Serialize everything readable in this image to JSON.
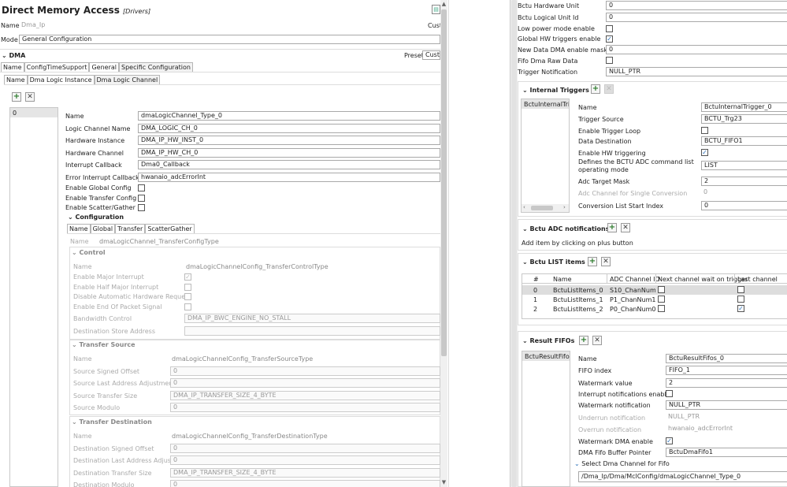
{
  "left": {
    "title": "Direct Memory Access",
    "title_suffix": "[Drivers]",
    "name_label": "Name",
    "name_value": "Dma_Ip",
    "custom_label": "Cust",
    "mode_label": "Mode",
    "mode_value": "General Configuration",
    "dma_section": "DMA",
    "preset_label": "Preset",
    "preset_value": "Custo",
    "top_tabs": [
      "Name",
      "ConfigTimeSupport",
      "General",
      "Specific Configuration"
    ],
    "sub_tabs": [
      "Name",
      "Dma Logic Instance",
      "Dma Logic Channel"
    ],
    "list_items": [
      "0"
    ],
    "fields": [
      {
        "label": "Name",
        "value": "dmaLogicChannel_Type_0"
      },
      {
        "label": "Logic Channel Name",
        "value": "DMA_LOGIC_CH_0"
      },
      {
        "label": "Hardware Instance",
        "value": "DMA_IP_HW_INST_0"
      },
      {
        "label": "Hardware Channel",
        "value": "DMA_IP_HW_CH_0"
      },
      {
        "label": "Interrupt Callback",
        "value": "Dma0_Callback"
      },
      {
        "label": "Error Interrupt Callback",
        "value": "hwanaio_adcErrorInt"
      }
    ],
    "checks": [
      {
        "label": "Enable Global Config",
        "checked": false
      },
      {
        "label": "Enable Transfer Config",
        "checked": false
      },
      {
        "label": "Enable Scatter/Gather",
        "checked": false
      }
    ],
    "configuration_section": "Configuration",
    "config_tabs": [
      "Name",
      "Global",
      "Transfer",
      "ScatterGather"
    ],
    "config_name_label": "Name",
    "config_name_value": "dmaLogicChannel_TransferConfigType",
    "control": {
      "title": "Control",
      "name_label": "Name",
      "name_value": "dmaLogicChannelConfig_TransferControlType",
      "checks": [
        {
          "label": "Enable Major Interrupt",
          "checked": true
        },
        {
          "label": "Enable Half Major Interrupt",
          "checked": false
        },
        {
          "label": "Disable Automatic Hardware Request",
          "checked": false
        },
        {
          "label": "Enable End Of Packet Signal",
          "checked": false
        }
      ],
      "bw_label": "Bandwidth Control",
      "bw_value": "DMA_IP_BWC_ENGINE_NO_STALL",
      "dest_store_label": "Destination Store Address",
      "dest_store_value": ""
    },
    "source": {
      "title": "Transfer Source",
      "rows": [
        {
          "label": "Name",
          "value": "dmaLogicChannelConfig_TransferSourceType"
        },
        {
          "label": "Source Signed Offset",
          "value": "0"
        },
        {
          "label": "Source Last Address Adjustment",
          "value": "0"
        },
        {
          "label": "Source Transfer Size",
          "value": "DMA_IP_TRANSFER_SIZE_4_BYTE"
        },
        {
          "label": "Source Modulo",
          "value": "0"
        }
      ]
    },
    "dest": {
      "title": "Transfer Destination",
      "rows": [
        {
          "label": "Name",
          "value": "dmaLogicChannelConfig_TransferDestinationType"
        },
        {
          "label": "Destination Signed Offset",
          "value": "0"
        },
        {
          "label": "Destination Last Address Adjustment",
          "value": "0"
        },
        {
          "label": "Destination Transfer Size",
          "value": "DMA_IP_TRANSFER_SIZE_4_BYTE"
        },
        {
          "label": "Destination Modulo",
          "value": "0"
        }
      ]
    }
  },
  "right": {
    "top_fields": [
      {
        "label": "Bctu Hardware Unit",
        "value": "0"
      },
      {
        "label": "Bctu Logical Unit Id",
        "value": "0"
      }
    ],
    "top_checks": [
      {
        "label": "Low power mode enable",
        "checked": false
      },
      {
        "label": "Global HW triggers enable",
        "checked": true
      }
    ],
    "new_data_label": "New Data DMA enable mask",
    "new_data_value": "0",
    "fifo_raw_label": "Fifo Dma Raw Data",
    "trigger_notif_label": "Trigger Notification",
    "trigger_notif_value": "NULL_PTR",
    "internal_triggers": {
      "title": "Internal Triggers",
      "list_item": "BctuInternalTrigg",
      "rows": [
        {
          "label": "Name",
          "value": "BctuInternalTrigger_0",
          "type": "field"
        },
        {
          "label": "Trigger Source",
          "value": "BCTU_Trg23",
          "type": "field"
        },
        {
          "label": "Enable Trigger Loop",
          "checked": false,
          "type": "check"
        },
        {
          "label": "Data Destination",
          "value": "BCTU_FIFO1",
          "type": "field"
        },
        {
          "label": "Enable HW triggering",
          "checked": true,
          "type": "check"
        }
      ],
      "cmd_label_1": "Defines the BCTU ADC command list",
      "cmd_label_2": "operating mode",
      "cmd_value": "LIST",
      "mask_label": "Adc Target Mask",
      "mask_value": "2",
      "single_label": "Adc Channel for Single Conversion",
      "single_value": "0",
      "start_label": "Conversion List Start Index",
      "start_value": "0"
    },
    "adc_notif": {
      "title": "Bctu ADC notifications",
      "hint": "Add item by clicking on plus button"
    },
    "list_items": {
      "title": "Bctu LIST items",
      "columns": [
        "#",
        "Name",
        "ADC Channel ID",
        "Next channel wait on trigger",
        "Last channel"
      ],
      "rows": [
        {
          "idx": "0",
          "name": "BctuListItems_0",
          "adc": "S10_ChanNum...",
          "next": false,
          "last": false
        },
        {
          "idx": "1",
          "name": "BctuListItems_1",
          "adc": "P1_ChanNum1",
          "next": false,
          "last": false
        },
        {
          "idx": "2",
          "name": "BctuListItems_2",
          "adc": "P0_ChanNum0",
          "next": false,
          "last": true
        }
      ]
    },
    "result_fifos": {
      "title": "Result FIFOs",
      "list_item": "BctuResultFifos_0",
      "name_label": "Name",
      "name_value": "BctuResultFifos_0",
      "index_label": "FIFO index",
      "index_value": "FIFO_1",
      "watermark_label": "Watermark value",
      "watermark_value": "2",
      "int_label": "Interrupt notifications enable",
      "wm_notif_label": "Watermark notification",
      "wm_notif_value": "NULL_PTR",
      "under_label": "Underrun notification",
      "under_value": "NULL_PTR",
      "over_label": "Overrun notification",
      "over_value": "hwanaio_adcErrorInt",
      "wm_dma_label": "Watermark DMA enable",
      "buf_label": "DMA Fifo Buffer Pointer",
      "buf_value": "BctuDmaFifo1",
      "select_label": "Select Dma Channel for Fifo",
      "select_value": "/Dma_Ip/Dma/MclConfig/dmaLogicChannel_Type_0"
    }
  }
}
